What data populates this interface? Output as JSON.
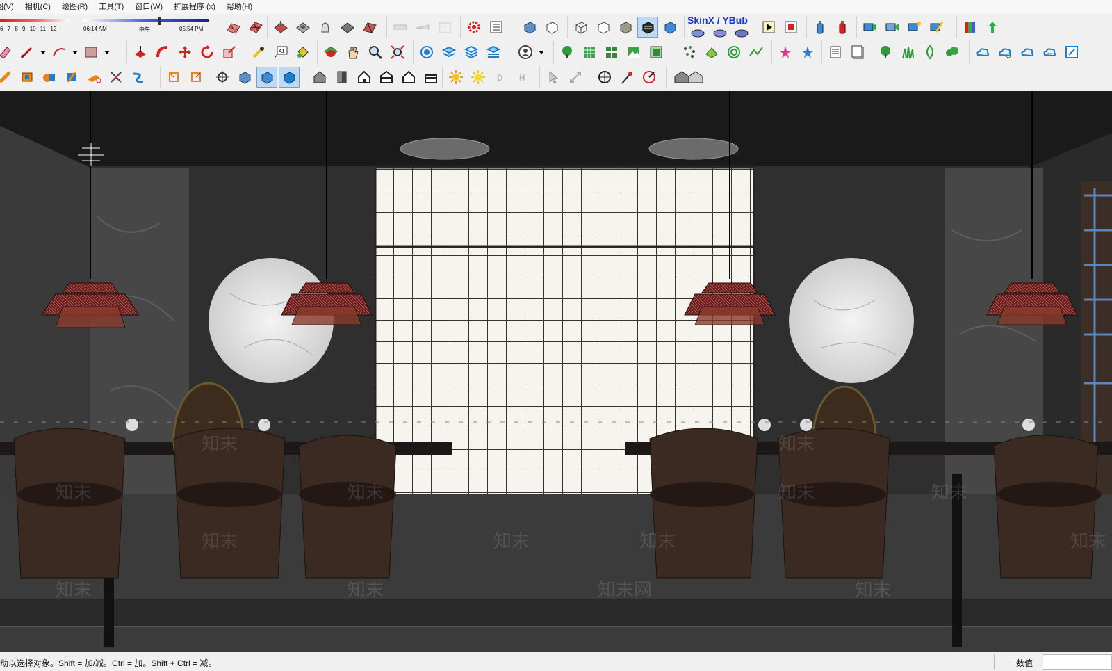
{
  "menu": {
    "items": [
      "图(V)",
      "相机(C)",
      "绘图(R)",
      "工具(T)",
      "窗口(W)",
      "扩展程序 (x)",
      "帮助(H)"
    ]
  },
  "shadow_settings": {
    "months_label": "6 7 8 9 10 11 12",
    "time_start": "06:14 AM",
    "time_mid": "中午",
    "time_end": "05:54 PM"
  },
  "plugins": {
    "skinx_label": "SkinX / YBub"
  },
  "viewport": {
    "watermark": "知末",
    "watermark_alt": "知末网"
  },
  "status": {
    "hint": "拖动以选择对象。Shift = 加/减。Ctrl = 加。Shift + Ctrl = 减。",
    "vcb_label": "数值",
    "vcb_value": ""
  },
  "colors": {
    "toolbar_bg": "#f0f0f0",
    "active_tool": "#bcd9f5",
    "skinx_blue": "#1a35d6",
    "lamp_red": "#8e2d2d",
    "wall_dark": "#2a2a2a"
  }
}
